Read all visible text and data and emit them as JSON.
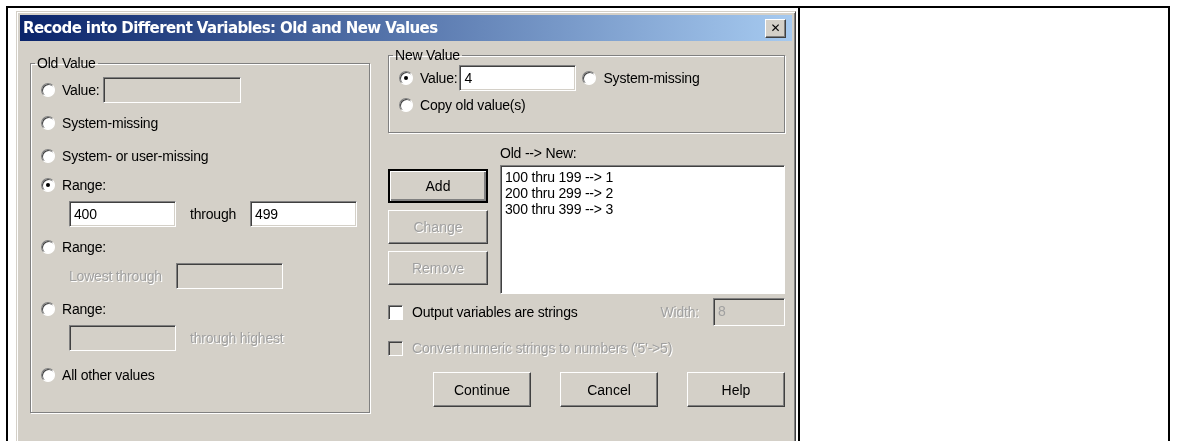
{
  "window": {
    "title": "Recode into Different Variables: Old and New Values",
    "close": "✕"
  },
  "old_value": {
    "legend": "Old Value",
    "options": [
      {
        "kind": "inline",
        "label": "Value:",
        "selected": false,
        "parts": [
          {
            "kind": "field",
            "disabled": true
          }
        ]
      },
      {
        "kind": "plain",
        "label": "System-missing",
        "selected": false
      },
      {
        "kind": "plain",
        "label": "System- or user-missing",
        "selected": false
      },
      {
        "kind": "block",
        "label": "Range:",
        "selected": true,
        "parts": [
          {
            "kind": "field",
            "value": "400",
            "disabled": false
          },
          {
            "kind": "text",
            "text": "through",
            "disabled": false
          },
          {
            "kind": "field",
            "value": "499",
            "disabled": false
          }
        ]
      },
      {
        "kind": "block",
        "label": "Range:",
        "selected": false,
        "parts": [
          {
            "kind": "text",
            "text": "Lowest through",
            "disabled": true
          },
          {
            "kind": "field",
            "disabled": true
          }
        ]
      },
      {
        "kind": "block",
        "label": "Range:",
        "selected": false,
        "parts": [
          {
            "kind": "field",
            "disabled": true
          },
          {
            "kind": "text",
            "text": "through highest",
            "disabled": true
          }
        ]
      },
      {
        "kind": "plain",
        "label": "All other values",
        "selected": false
      }
    ]
  },
  "new_value": {
    "legend": "New Value",
    "options": [
      {
        "label": "Value:",
        "selected": true,
        "field": {
          "value": "4",
          "disabled": false
        }
      },
      {
        "label": "System-missing",
        "selected": false
      },
      {
        "label": "Copy old value(s)",
        "selected": false
      }
    ]
  },
  "mapping": {
    "label": "Old --> New:",
    "items": [
      "100 thru 199 --> 1",
      "200 thru 299 --> 2",
      "300 thru 399 --> 3"
    ]
  },
  "list_buttons": [
    {
      "label": "Add",
      "disabled": false,
      "default": true
    },
    {
      "label": "Change",
      "disabled": true,
      "default": false
    },
    {
      "label": "Remove",
      "disabled": true,
      "default": false
    }
  ],
  "checkboxes": [
    {
      "label": "Output variables are strings",
      "checked": false,
      "disabled": false,
      "width": {
        "label": "Width:",
        "value": "8",
        "disabled": true
      }
    },
    {
      "label": "Convert numeric strings to numbers ('5'->5)",
      "checked": false,
      "disabled": true
    }
  ],
  "buttons": [
    "Continue",
    "Cancel",
    "Help"
  ]
}
